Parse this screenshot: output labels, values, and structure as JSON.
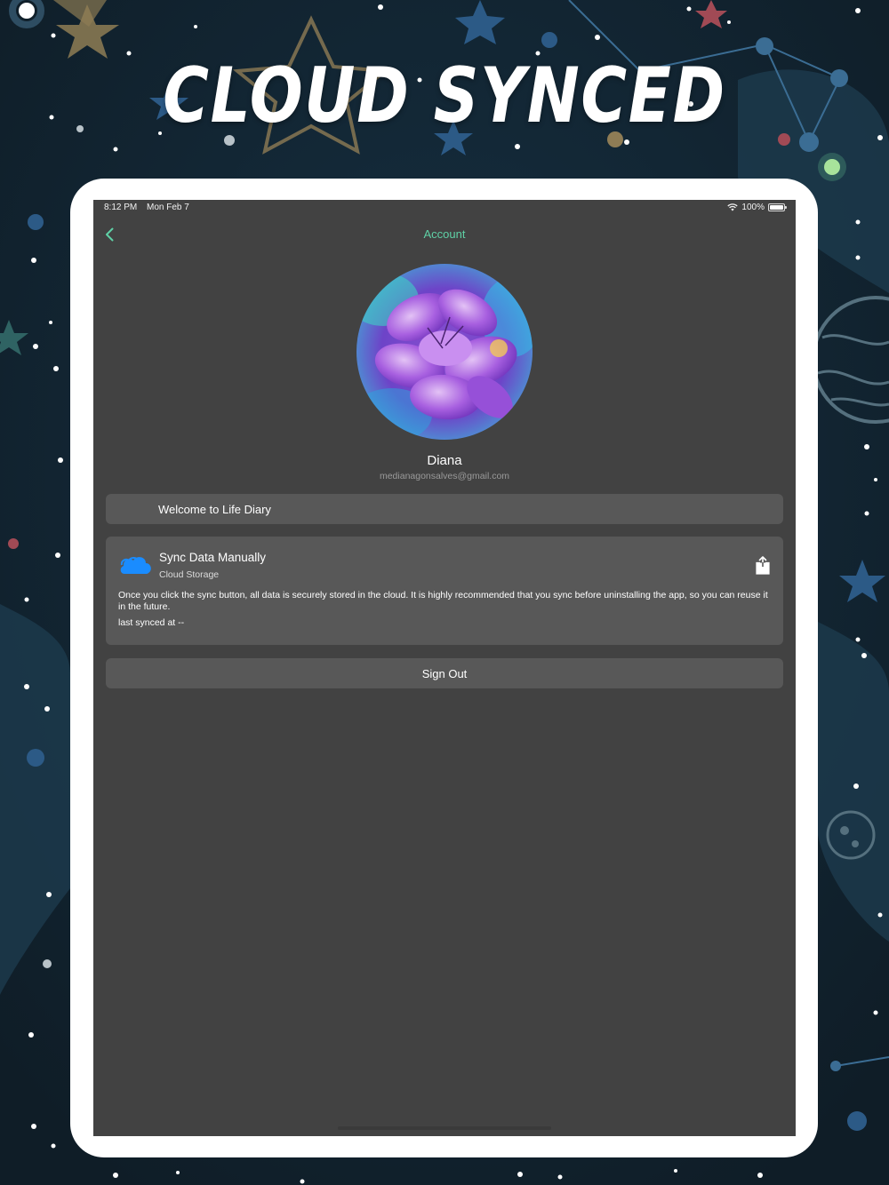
{
  "headline": "CLOUD SYNCED",
  "status_bar": {
    "time": "8:12 PM",
    "date": "Mon Feb 7",
    "battery": "100%",
    "battery_level": 1.0
  },
  "nav": {
    "title": "Account",
    "back_icon": "chevron-left-icon"
  },
  "profile": {
    "name": "Diana",
    "email": "medianagonsalves@gmail.com"
  },
  "welcome": {
    "text": "Welcome to Life Diary"
  },
  "sync": {
    "title": "Sync Data Manually",
    "subtitle": "Cloud Storage",
    "description": "Once you click the sync button, all data is securely stored in the cloud. It is highly recommended that you sync before uninstalling the app, so you can reuse it in the future.",
    "last_synced": "last synced at --",
    "icon": "cloud-icon",
    "action_icon": "share-icon"
  },
  "sign_out": {
    "label": "Sign Out"
  },
  "colors": {
    "accent": "#5fd1a6",
    "screen_bg": "#424242",
    "card_bg": "#585858",
    "page_bg": "#11202b",
    "cloud_blue": "#1a8cff"
  }
}
